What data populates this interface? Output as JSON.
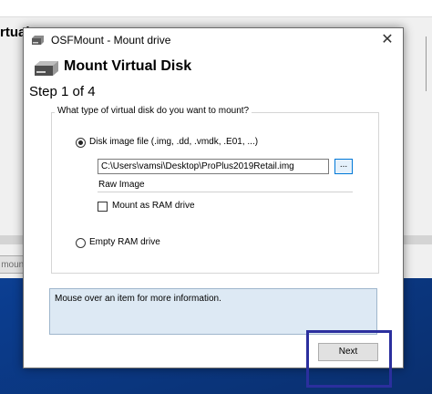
{
  "background_window": {
    "title_fragment": "rtual",
    "button_fragment": "mount"
  },
  "dialog": {
    "title": "OSFMount - Mount drive",
    "close_glyph": "✕",
    "header_title": "Mount Virtual Disk",
    "step": "Step 1 of 4",
    "question": "What type of virtual disk do you want to mount?",
    "option_disk_image": {
      "label": "Disk image file (.img, .dd, .vmdk, .E01, ...)",
      "selected": true
    },
    "image_path": "C:\\Users\\vamsi\\Desktop\\ProPlus2019Retail.img",
    "browse_label": "...",
    "image_type": "Raw Image",
    "mount_as_ram": {
      "label": "Mount as RAM drive",
      "checked": false
    },
    "option_empty_ram": {
      "label": "Empty RAM drive",
      "selected": false
    },
    "info_text": "Mouse over an item for more information.",
    "next_label": "Next"
  },
  "colors": {
    "desktop_blue": "#0b3d8f",
    "info_box": "#dde9f4",
    "highlight_border": "#2b2f9e"
  }
}
